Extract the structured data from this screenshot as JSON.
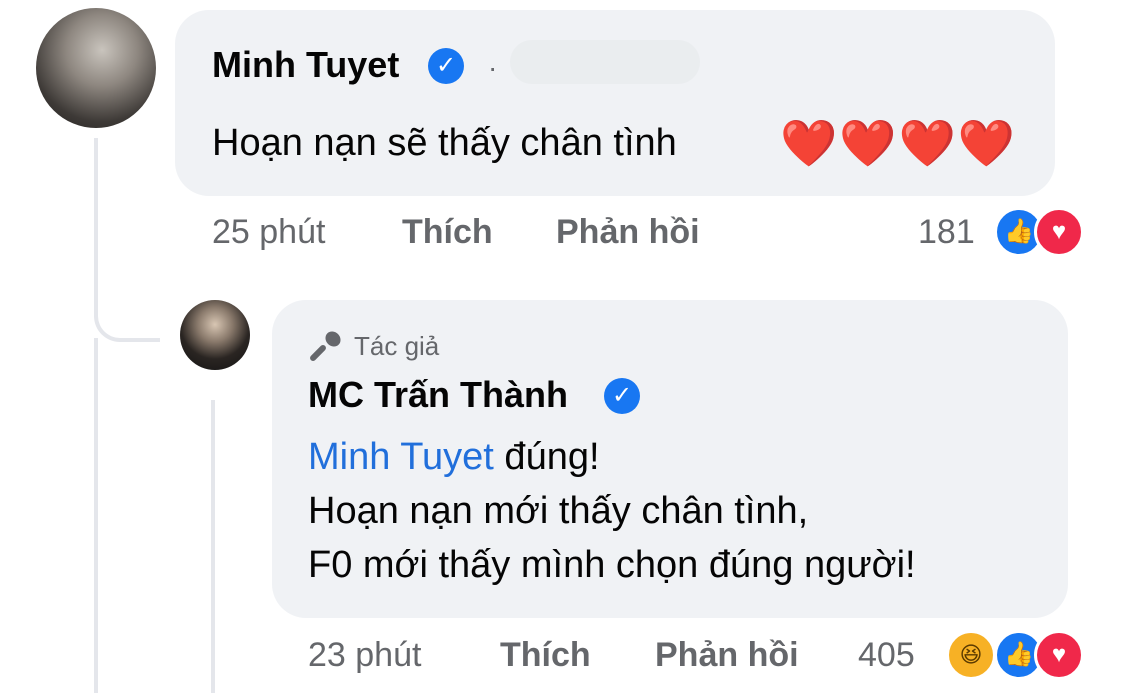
{
  "comment": {
    "author": "Minh Tuyet",
    "text": "Hoạn nạn sẽ thấy chân tình",
    "emoji": "❤️❤️❤️❤️",
    "time": "25 phút",
    "like_label": "Thích",
    "reply_label": "Phản hồi",
    "reaction_count": "181",
    "reactions": [
      "like",
      "love"
    ]
  },
  "reply": {
    "badge": "Tác giả",
    "author": "MC Trấn Thành",
    "mention": "Minh Tuyet",
    "line1_rest": " đúng!",
    "line2": "Hoạn nạn mới thấy chân tình,",
    "line3": "F0 mới thấy mình chọn đúng người!",
    "time": "23 phút",
    "like_label": "Thích",
    "reply_label": "Phản hồi",
    "reaction_count": "405",
    "reactions": [
      "haha",
      "like",
      "love"
    ]
  },
  "colors": {
    "bubble": "#f0f2f5",
    "verified": "#1877f2",
    "mention": "#216fdb",
    "meta": "#65676b"
  }
}
